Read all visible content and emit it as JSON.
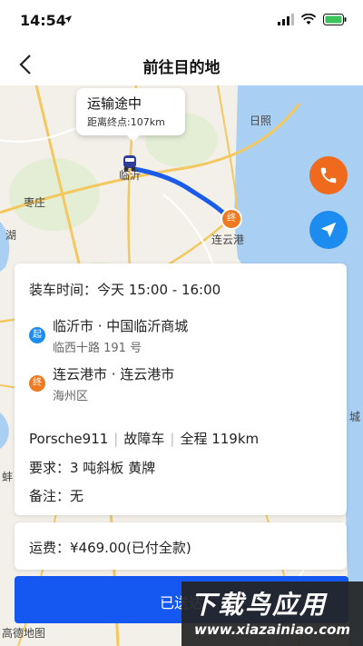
{
  "status": {
    "time": "14:54"
  },
  "nav": {
    "title": "前往目的地"
  },
  "map": {
    "labels": {
      "rizhao": "日照",
      "zaozhuang": "枣庄",
      "lianyungang": "连云港",
      "linyi": "临沂",
      "hu": "湖",
      "chengle": "城",
      "beng": "蚌"
    },
    "bubble": {
      "status": "运输途中",
      "distance": "距离终点:107km"
    },
    "end_marker": "终",
    "route_color": "#1a5bea"
  },
  "order": {
    "load_time": "装车时间：今天 15:00 - 16:00",
    "start_badge": "起",
    "start_city": "临沂市 · 中国临沂商城",
    "start_address": "临西十路 191 号",
    "end_badge": "终",
    "end_city": "连云港市 · 连云港市",
    "end_address": "海州区",
    "vehicle": "Porsche911",
    "vehicle_type": "故障车",
    "distance": "全程 119km",
    "requirement": "要求：3 吨斜板 黄牌",
    "note": "备注：无"
  },
  "fee": {
    "text": "运费：¥469.00(已付全款)"
  },
  "action": {
    "label": "已送达"
  },
  "footer": {
    "map_brand": "高德地图",
    "watermark_cn": "下载鸟应用",
    "watermark_url": "www.xiazainiao.com"
  },
  "colors": {
    "primary": "#1557f1",
    "start": "#1d8cf0",
    "end": "#f07a21",
    "phone": "#f06a1e",
    "locate": "#1d8cf0"
  }
}
